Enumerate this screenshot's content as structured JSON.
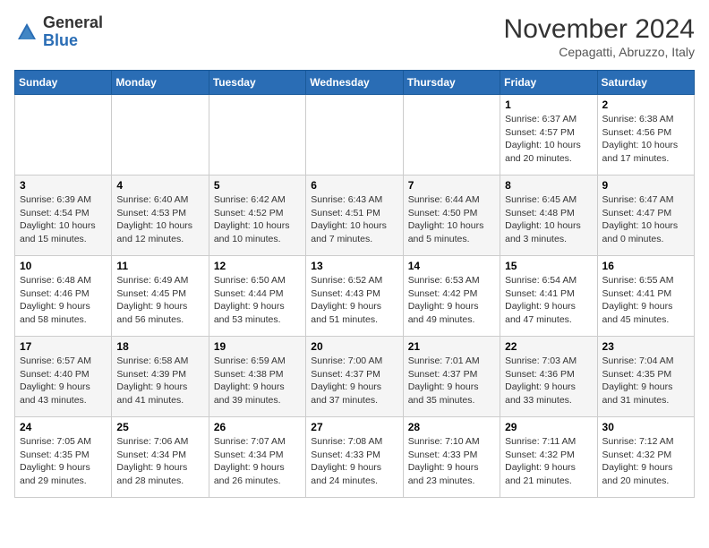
{
  "logo": {
    "general": "General",
    "blue": "Blue"
  },
  "title": "November 2024",
  "location": "Cepagatti, Abruzzo, Italy",
  "days_header": [
    "Sunday",
    "Monday",
    "Tuesday",
    "Wednesday",
    "Thursday",
    "Friday",
    "Saturday"
  ],
  "weeks": [
    [
      {
        "day": "",
        "info": ""
      },
      {
        "day": "",
        "info": ""
      },
      {
        "day": "",
        "info": ""
      },
      {
        "day": "",
        "info": ""
      },
      {
        "day": "",
        "info": ""
      },
      {
        "day": "1",
        "info": "Sunrise: 6:37 AM\nSunset: 4:57 PM\nDaylight: 10 hours and 20 minutes."
      },
      {
        "day": "2",
        "info": "Sunrise: 6:38 AM\nSunset: 4:56 PM\nDaylight: 10 hours and 17 minutes."
      }
    ],
    [
      {
        "day": "3",
        "info": "Sunrise: 6:39 AM\nSunset: 4:54 PM\nDaylight: 10 hours and 15 minutes."
      },
      {
        "day": "4",
        "info": "Sunrise: 6:40 AM\nSunset: 4:53 PM\nDaylight: 10 hours and 12 minutes."
      },
      {
        "day": "5",
        "info": "Sunrise: 6:42 AM\nSunset: 4:52 PM\nDaylight: 10 hours and 10 minutes."
      },
      {
        "day": "6",
        "info": "Sunrise: 6:43 AM\nSunset: 4:51 PM\nDaylight: 10 hours and 7 minutes."
      },
      {
        "day": "7",
        "info": "Sunrise: 6:44 AM\nSunset: 4:50 PM\nDaylight: 10 hours and 5 minutes."
      },
      {
        "day": "8",
        "info": "Sunrise: 6:45 AM\nSunset: 4:48 PM\nDaylight: 10 hours and 3 minutes."
      },
      {
        "day": "9",
        "info": "Sunrise: 6:47 AM\nSunset: 4:47 PM\nDaylight: 10 hours and 0 minutes."
      }
    ],
    [
      {
        "day": "10",
        "info": "Sunrise: 6:48 AM\nSunset: 4:46 PM\nDaylight: 9 hours and 58 minutes."
      },
      {
        "day": "11",
        "info": "Sunrise: 6:49 AM\nSunset: 4:45 PM\nDaylight: 9 hours and 56 minutes."
      },
      {
        "day": "12",
        "info": "Sunrise: 6:50 AM\nSunset: 4:44 PM\nDaylight: 9 hours and 53 minutes."
      },
      {
        "day": "13",
        "info": "Sunrise: 6:52 AM\nSunset: 4:43 PM\nDaylight: 9 hours and 51 minutes."
      },
      {
        "day": "14",
        "info": "Sunrise: 6:53 AM\nSunset: 4:42 PM\nDaylight: 9 hours and 49 minutes."
      },
      {
        "day": "15",
        "info": "Sunrise: 6:54 AM\nSunset: 4:41 PM\nDaylight: 9 hours and 47 minutes."
      },
      {
        "day": "16",
        "info": "Sunrise: 6:55 AM\nSunset: 4:41 PM\nDaylight: 9 hours and 45 minutes."
      }
    ],
    [
      {
        "day": "17",
        "info": "Sunrise: 6:57 AM\nSunset: 4:40 PM\nDaylight: 9 hours and 43 minutes."
      },
      {
        "day": "18",
        "info": "Sunrise: 6:58 AM\nSunset: 4:39 PM\nDaylight: 9 hours and 41 minutes."
      },
      {
        "day": "19",
        "info": "Sunrise: 6:59 AM\nSunset: 4:38 PM\nDaylight: 9 hours and 39 minutes."
      },
      {
        "day": "20",
        "info": "Sunrise: 7:00 AM\nSunset: 4:37 PM\nDaylight: 9 hours and 37 minutes."
      },
      {
        "day": "21",
        "info": "Sunrise: 7:01 AM\nSunset: 4:37 PM\nDaylight: 9 hours and 35 minutes."
      },
      {
        "day": "22",
        "info": "Sunrise: 7:03 AM\nSunset: 4:36 PM\nDaylight: 9 hours and 33 minutes."
      },
      {
        "day": "23",
        "info": "Sunrise: 7:04 AM\nSunset: 4:35 PM\nDaylight: 9 hours and 31 minutes."
      }
    ],
    [
      {
        "day": "24",
        "info": "Sunrise: 7:05 AM\nSunset: 4:35 PM\nDaylight: 9 hours and 29 minutes."
      },
      {
        "day": "25",
        "info": "Sunrise: 7:06 AM\nSunset: 4:34 PM\nDaylight: 9 hours and 28 minutes."
      },
      {
        "day": "26",
        "info": "Sunrise: 7:07 AM\nSunset: 4:34 PM\nDaylight: 9 hours and 26 minutes."
      },
      {
        "day": "27",
        "info": "Sunrise: 7:08 AM\nSunset: 4:33 PM\nDaylight: 9 hours and 24 minutes."
      },
      {
        "day": "28",
        "info": "Sunrise: 7:10 AM\nSunset: 4:33 PM\nDaylight: 9 hours and 23 minutes."
      },
      {
        "day": "29",
        "info": "Sunrise: 7:11 AM\nSunset: 4:32 PM\nDaylight: 9 hours and 21 minutes."
      },
      {
        "day": "30",
        "info": "Sunrise: 7:12 AM\nSunset: 4:32 PM\nDaylight: 9 hours and 20 minutes."
      }
    ]
  ]
}
